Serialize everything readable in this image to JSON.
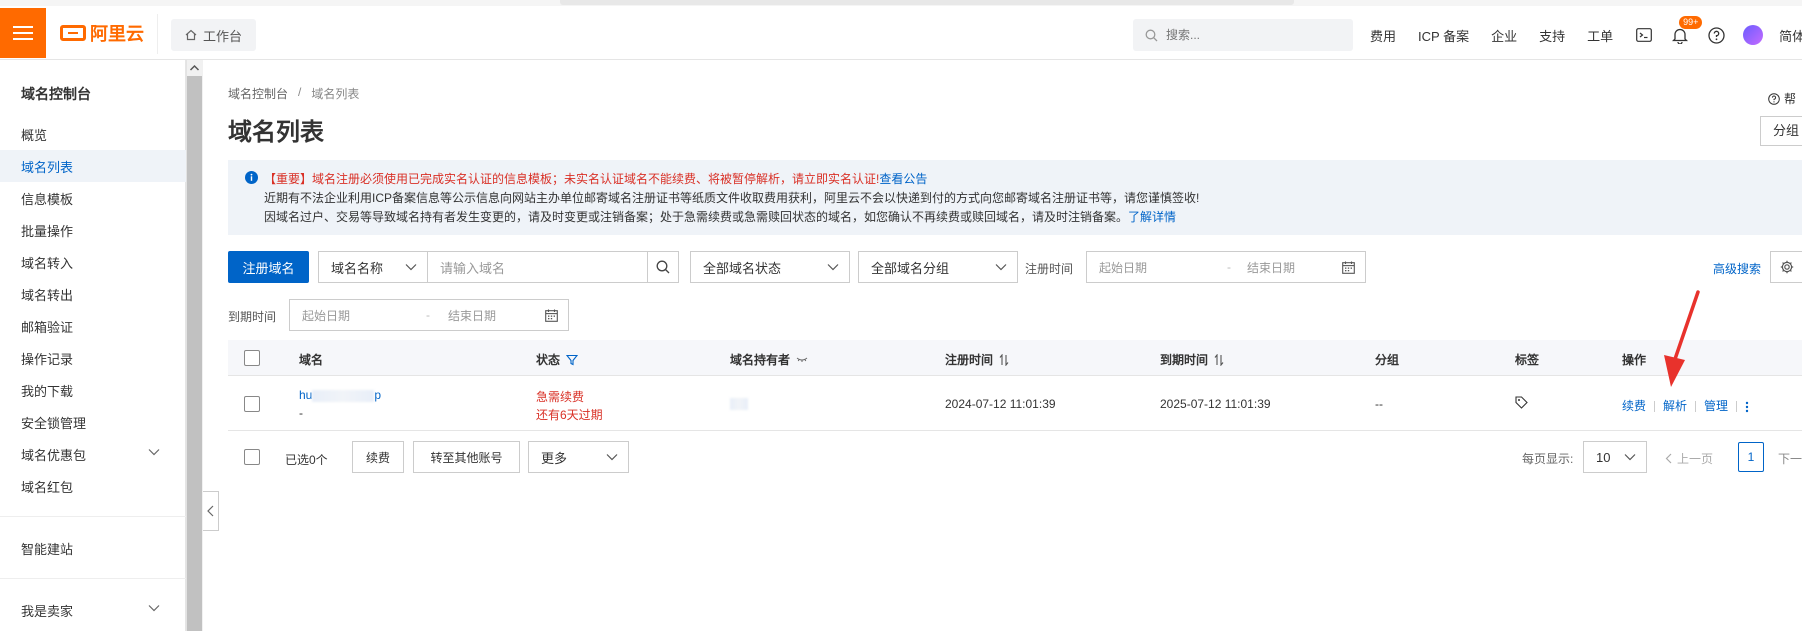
{
  "topbar": {
    "logo_text": "阿里云",
    "workbench_label": "工作台",
    "search_placeholder": "搜索...",
    "links": [
      "费用",
      "ICP 备案",
      "企业",
      "支持",
      "工单"
    ],
    "notification_badge": "99+",
    "language_label": "简体",
    "brand_color": "#ff6a00"
  },
  "sidebar": {
    "title": "域名控制台",
    "items": [
      {
        "label": "概览"
      },
      {
        "label": "域名列表",
        "active": true
      },
      {
        "label": "信息模板"
      },
      {
        "label": "批量操作"
      },
      {
        "label": "域名转入"
      },
      {
        "label": "域名转出"
      },
      {
        "label": "邮箱验证"
      },
      {
        "label": "操作记录"
      },
      {
        "label": "我的下载"
      },
      {
        "label": "安全锁管理"
      },
      {
        "label": "域名优惠包",
        "expandable": true
      },
      {
        "label": "域名红包"
      }
    ],
    "extra_items": [
      {
        "label": "智能建站"
      },
      {
        "label": "我是卖家",
        "expandable": true
      }
    ]
  },
  "breadcrumb": [
    "域名控制台",
    "/",
    "域名列表"
  ],
  "page_title": "域名列表",
  "help_label": "帮",
  "group_button_label": "分组",
  "notice": {
    "line1": "【重要】域名注册必须使用已完成实名认证的信息模板；未实名认证域名不能续费、将被暂停解析，请立即实名认证!",
    "line1_link": "查看公告",
    "line2": "近期有不法企业利用ICP备案信息等公示信息向网站主办单位邮寄域名注册证书等纸质文件收取费用获利，阿里云不会以快递到付的方式向您邮寄域名注册证书等，请您谨慎签收!",
    "line3": "因域名过户、交易等导致域名持有者发生变更的，请及时变更或注销备案；处于急需续费或急需赎回状态的域名，如您确认不再续费或赎回域名，请及时注销备案。",
    "line3_link": "了解详情"
  },
  "filters": {
    "register_button": "注册域名",
    "name_select": "域名名称",
    "name_input_placeholder": "请输入域名",
    "status_select": "全部域名状态",
    "group_select": "全部域名分组",
    "reg_time_label": "注册时间",
    "start_placeholder": "起始日期",
    "dash": "-",
    "end_placeholder": "结束日期",
    "expire_time_label": "到期时间",
    "advanced_search": "高级搜索"
  },
  "table": {
    "columns": [
      "域名",
      "状态",
      "域名持有者",
      "注册时间",
      "到期时间",
      "分组",
      "标签",
      "操作"
    ],
    "rows": [
      {
        "domain_prefix": "hu",
        "domain_suffix": "p",
        "domain_sub": "-",
        "status_line1": "急需续费",
        "status_line2": "还有6天过期",
        "reg_time": "2024-07-12 11:01:39",
        "expire_time": "2025-07-12 11:01:39",
        "group": "--",
        "ops": [
          "续费",
          "解析",
          "管理"
        ]
      }
    ]
  },
  "footer": {
    "selected_label": "已选0个",
    "renew_button": "续费",
    "transfer_button": "转至其他账号",
    "more_select": "更多",
    "per_page_label": "每页显示:",
    "per_page_value": "10",
    "prev_label": "上一页",
    "current_page": "1",
    "next_label": "下一"
  },
  "colors": {
    "primary": "#0064c8",
    "danger": "#d93026",
    "annotation_arrow": "#e8322c"
  }
}
